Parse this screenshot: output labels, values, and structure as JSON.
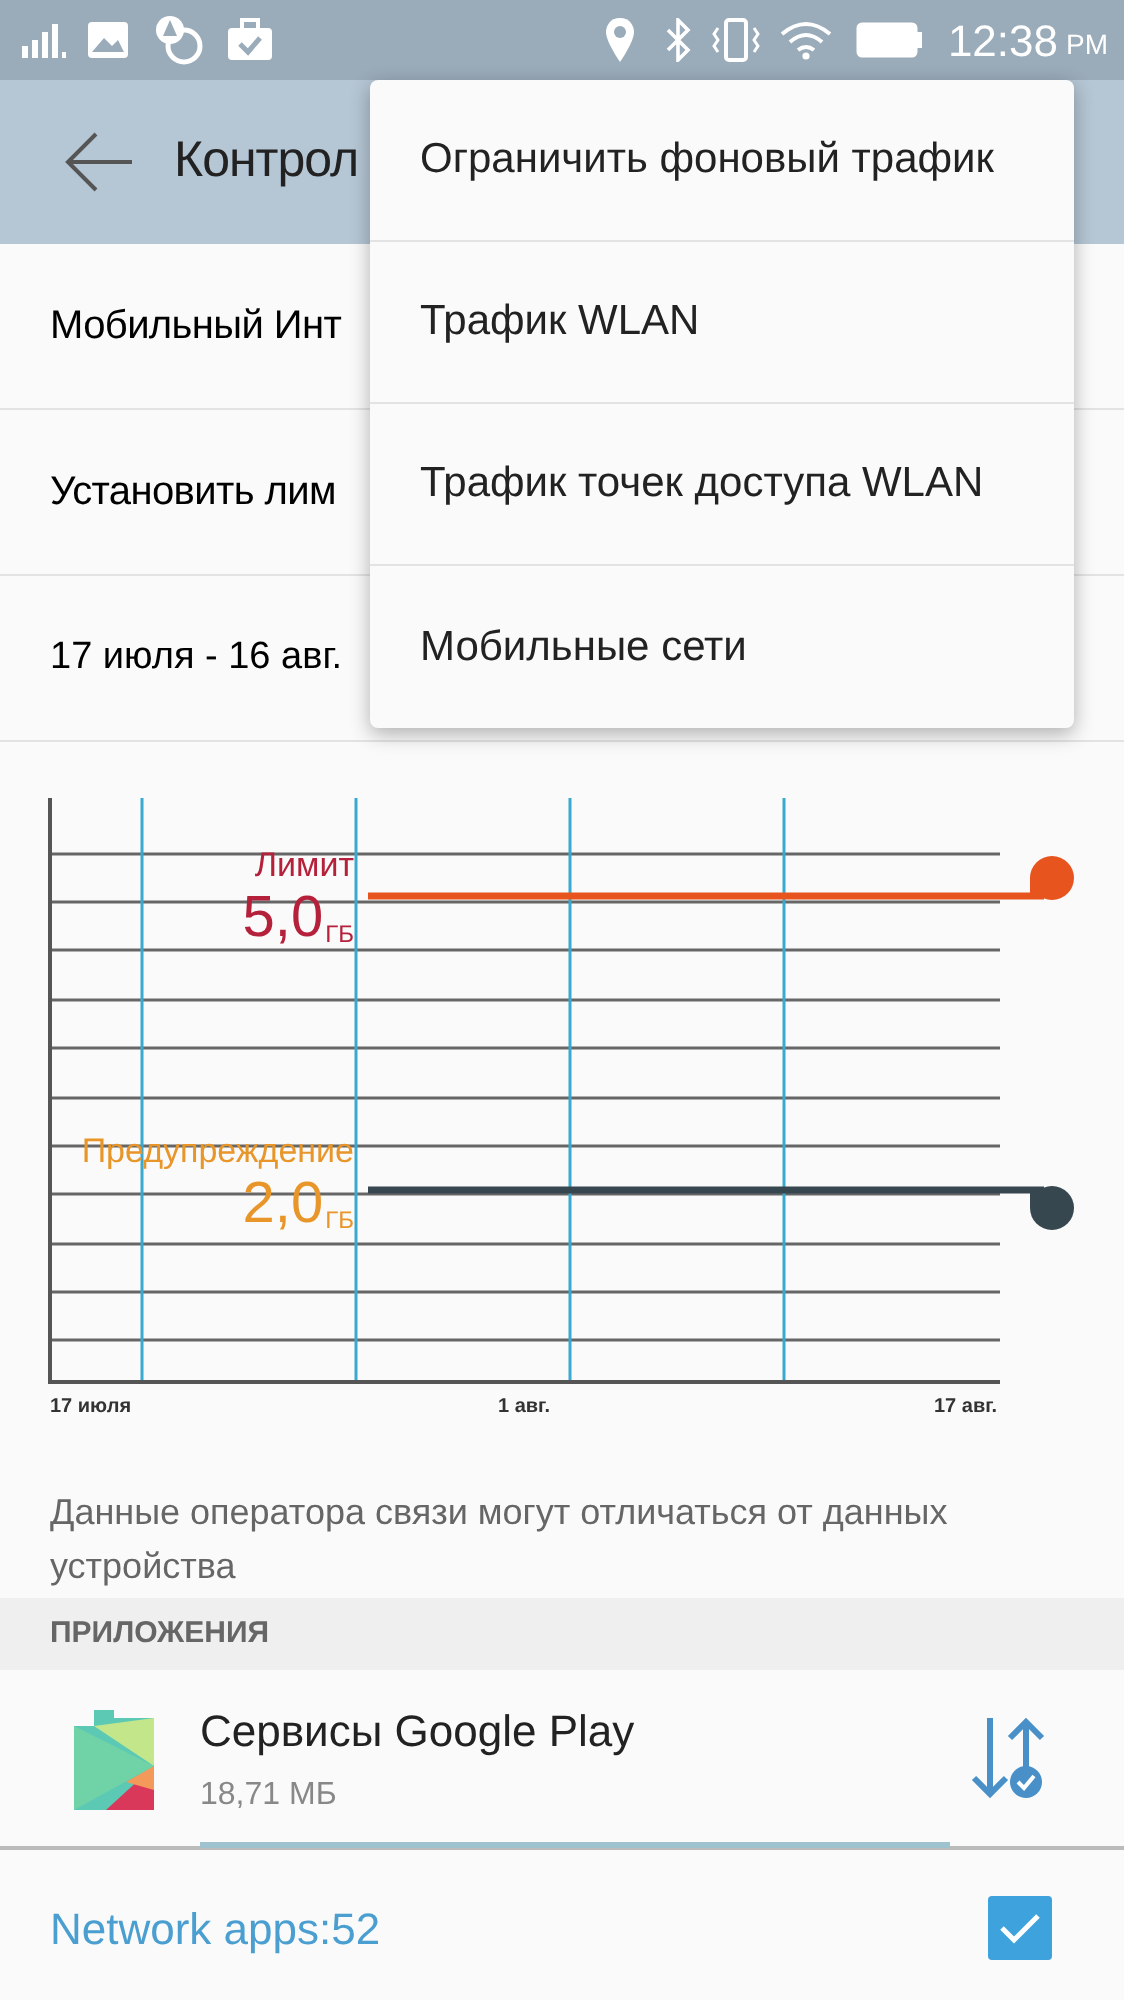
{
  "status_bar": {
    "time": "12:38",
    "ampm": "PM"
  },
  "toolbar": {
    "title": "Контрол"
  },
  "settings": [
    {
      "label": "Мобильный Инт"
    },
    {
      "label": "Установить лим"
    },
    {
      "label": "17 июля - 16 авг."
    }
  ],
  "chart": {
    "markers": [
      {
        "kind": "limit",
        "label": "Лимит",
        "value": "5,0",
        "unit": "ГБ",
        "color": "#e8541e"
      },
      {
        "kind": "warning",
        "label": "Предупреждение",
        "value": "2,0",
        "unit": "ГБ",
        "color": "#37474f"
      }
    ],
    "x_labels": [
      "17 июля",
      "1 авг.",
      "17 авг."
    ]
  },
  "note": "Данные оператора связи могут отличаться от данных устройства",
  "section": "ПРИЛОЖЕНИЯ",
  "apps": [
    {
      "name": "Сервисы Google Play",
      "size": "18,71 МБ",
      "level": 1
    }
  ],
  "footer": {
    "label": "Network apps:52",
    "checked": true
  },
  "menu": {
    "items": [
      {
        "label": "Ограничить фоновый трафик"
      },
      {
        "label": "Трафик WLAN"
      },
      {
        "label": "Трафик точек доступа WLAN"
      },
      {
        "label": "Мобильные сети"
      }
    ]
  }
}
